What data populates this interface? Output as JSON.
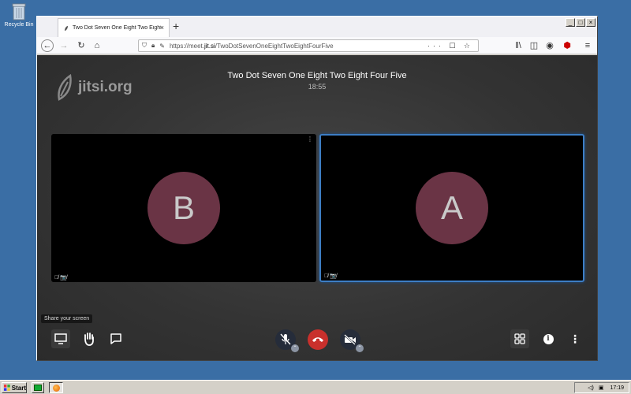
{
  "desktop": {
    "recycle_bin_label": "Recycle Bin"
  },
  "browser": {
    "tab_title": "Two Dot Seven One Eight Two Eight Four Five",
    "tab_close": "×",
    "new_tab": "+",
    "url_prefix": "https://meet.",
    "url_domain": "jit.si",
    "url_path": "/TwoDotSevenOneEightTwoEightFourFive",
    "url_actions": "··· ☐ ☆",
    "window_buttons": [
      "_",
      "□",
      "×"
    ]
  },
  "meeting": {
    "logo_text": "jitsi.org",
    "title": "Two Dot Seven One Eight Two Eight Four Five",
    "time": "18:55"
  },
  "participants": [
    {
      "initial": "B",
      "status": "🎙̸ 📷̸"
    },
    {
      "initial": "A",
      "status": "🎙̸ 📷̸"
    }
  ],
  "tile_menu": "⋮",
  "toolbar": {
    "share_tooltip": "Share your screen",
    "more_icon": "⋮",
    "info_icon": "i",
    "caret": "⌃"
  },
  "colors": {
    "avatar": "#6a3445",
    "hangup": "#c9302c",
    "active_border": "#3d7ec5",
    "desktop": "#3a6ea5"
  },
  "taskbar": {
    "start_label": "Start",
    "clock": "17:19"
  }
}
